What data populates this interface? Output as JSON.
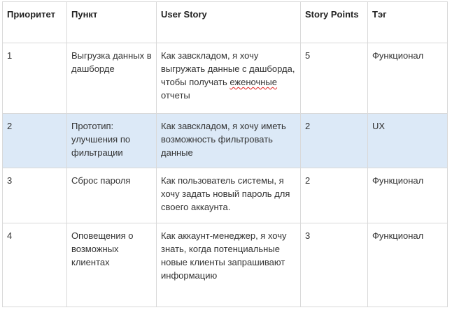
{
  "headers": {
    "priority": "Приоритет",
    "item": "Пункт",
    "story": "User Story",
    "points": "Story Points",
    "tag": "Тэг"
  },
  "rows": [
    {
      "priority": "1",
      "item": "Выгрузка данных в дашборде",
      "story_pre": "Как завскладом, я хочу выгружать данные с дашборда, чтобы получать ",
      "story_flagged_word": "еженочные",
      "story_post": " отчеты",
      "points": "5",
      "tag": "Функционал"
    },
    {
      "priority": "2",
      "item": "Прототип: улучшения по фильтрации",
      "story": "Как завскладом, я хочу иметь возможность фильтровать данные",
      "points": "2",
      "tag": "UX",
      "highlighted": true
    },
    {
      "priority": "3",
      "item": "Сброс пароля",
      "story": "Как пользователь системы, я хочу задать новый пароль для своего аккаунта.",
      "points": "2",
      "tag": "Функционал"
    },
    {
      "priority": "4",
      "item": "Оповещения о возможных клиентах",
      "story": "Как аккаунт-менеджер, я хочу знать, когда потенциальные новые клиенты запрашивают информацию",
      "points": "3",
      "tag": "Функционал"
    }
  ],
  "colors": {
    "highlight_row": "#dce9f7",
    "border": "#d9d9d9",
    "spellcheck_underline": "#e02020"
  }
}
